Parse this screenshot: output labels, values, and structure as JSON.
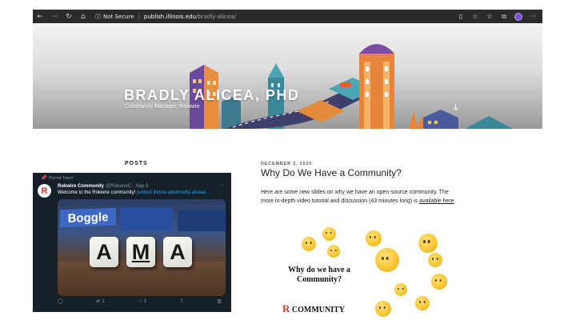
{
  "browser": {
    "security_label": "Not Secure",
    "url_domain": "publish.illinois.edu",
    "url_path": "/bradly-alicea/"
  },
  "hero": {
    "title": "BRADLY ALICEA, PHD",
    "subtitle": "Community Manager, Rokwire"
  },
  "posts": {
    "heading": "POSTS"
  },
  "tweet": {
    "pinned_label": "Pinned Tweet",
    "avatar_letter": "R",
    "name": "Rokwire Community",
    "handle": "@RokwireC · Sep 9",
    "text": "Welcome to the Rokwire community!",
    "link": "publish.illinois.edu/bradly-alicea/...",
    "image": {
      "boggle_text": "Boggle",
      "dice": [
        "A",
        "M",
        "A"
      ]
    },
    "reply_count": "",
    "retweet_count": "1",
    "like_count": "1"
  },
  "article": {
    "date": "DECEMBER 2, 2020",
    "title": "Why Do We Have a Community?",
    "body": "Here are some new slides on why we have an open-source community. The more in-depth video tutorial and discussion (43 minutes long) is",
    "link_text": "available here",
    "body_end": ".",
    "image": {
      "question": "Why do we have a Community?",
      "brand_letter": "R",
      "brand_text": "COMMUNITY"
    }
  }
}
